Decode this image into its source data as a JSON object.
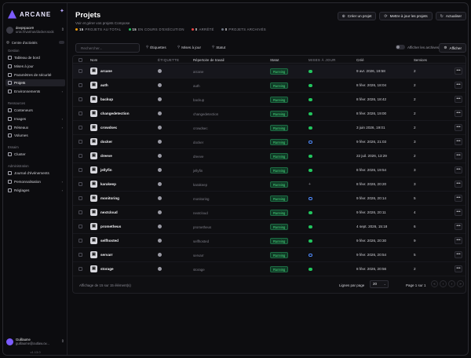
{
  "sidebar": {
    "logo_text": "ARCANE",
    "environment": {
      "name": "deepspace9",
      "url": "unix:///var/run/docker.sock"
    },
    "activity_label": "Centre d'activités",
    "sections": {
      "gestion": "Gestion",
      "ressources": "Ressources",
      "essaim": "Essaim",
      "administration": "Administration"
    },
    "gestion_items": [
      {
        "label": "Tableau de bord",
        "icon": "dashboard-icon"
      },
      {
        "label": "Mises à jour",
        "icon": "update-icon"
      },
      {
        "label": "Paramètres de sécurité",
        "icon": "shield-icon"
      },
      {
        "label": "Projets",
        "icon": "projects-icon"
      },
      {
        "label": "Environnements",
        "icon": "server-icon"
      }
    ],
    "ressources_items": [
      {
        "label": "Conteneurs",
        "icon": "container-icon"
      },
      {
        "label": "Images",
        "icon": "image-icon"
      },
      {
        "label": "Réseaux",
        "icon": "network-icon"
      },
      {
        "label": "Volumes",
        "icon": "volume-icon"
      }
    ],
    "essaim_items": [
      {
        "label": "Cluster",
        "icon": "cluster-icon"
      }
    ],
    "admin_items": [
      {
        "label": "Journal d'événements",
        "icon": "log-icon"
      },
      {
        "label": "Personnalisation",
        "icon": "brush-icon"
      },
      {
        "label": "Réglages",
        "icon": "settings-icon"
      }
    ],
    "user": {
      "name": "Guillaume",
      "email": "guillaume@outlaw.ov..."
    },
    "version": "v1.13.0"
  },
  "header": {
    "title": "Projets",
    "subtitle": "Voir et gérer vos projets Compose",
    "stats": [
      {
        "count": "15",
        "label": "PROJETS AU TOTAL",
        "color": "#f59e0b"
      },
      {
        "count": "15",
        "label": "EN COURS D'EXÉCUTION",
        "color": "#22c55e"
      },
      {
        "count": "0",
        "label": "ARRÊTÉ",
        "color": "#ef4444"
      },
      {
        "count": "0",
        "label": "PROJETS ARCHIVÉS",
        "color": "#6b7280"
      }
    ],
    "buttons": {
      "create": "Créer un projet",
      "update_all": "Mettre à jour les projets",
      "refresh": "Actualiser"
    }
  },
  "toolbar": {
    "search_placeholder": "Rechercher...",
    "filters": [
      "Étiquettes",
      "Mises à jour",
      "Statut"
    ],
    "archive_label": "Afficher les archives",
    "view_label": "Afficher"
  },
  "table": {
    "columns": {
      "name": "Nom",
      "tags": "ÉTIQUETTE",
      "dir": "Répertoire de travail",
      "status": "Statut",
      "updates": "MISES À JOUR",
      "created": "Créé",
      "services": "Services"
    },
    "rows": [
      {
        "name": "arcane",
        "dir": "arcane",
        "status": "Running",
        "update": "ok",
        "created": "9 avr. 2026, 19:58",
        "services": "2"
      },
      {
        "name": "auth",
        "dir": "auth",
        "status": "Running",
        "update": "ok",
        "created": "8 févr. 2026, 18:04",
        "services": "2"
      },
      {
        "name": "backup",
        "dir": "backup",
        "status": "Running",
        "update": "ok",
        "created": "8 févr. 2026, 18:42",
        "services": "2"
      },
      {
        "name": "changedetection",
        "dir": "changedetection",
        "status": "Running",
        "update": "ok",
        "created": "8 févr. 2026, 19:00",
        "services": "2"
      },
      {
        "name": "crowdsec",
        "dir": "crowdsec",
        "status": "Running",
        "update": "ok",
        "created": "3 juin 2026, 19:01",
        "services": "2"
      },
      {
        "name": "docker",
        "dir": "docker",
        "status": "Running",
        "update": "ring",
        "created": "9 févr. 2026, 21:03",
        "services": "3"
      },
      {
        "name": "dreeve",
        "dir": "dreeve",
        "status": "Running",
        "update": "ok",
        "created": "22 juil. 2026, 13:29",
        "services": "2"
      },
      {
        "name": "jellyfin",
        "dir": "jellyfin",
        "status": "Running",
        "update": "ok",
        "created": "8 févr. 2026, 19:54",
        "services": "3"
      },
      {
        "name": "karakeep",
        "dir": "karakeep",
        "status": "Running",
        "update": "plus",
        "created": "8 févr. 2026, 20:20",
        "services": "3"
      },
      {
        "name": "monitoring",
        "dir": "monitoring",
        "status": "Running",
        "update": "ring",
        "created": "9 févr. 2026, 20:14",
        "services": "5"
      },
      {
        "name": "nextcloud",
        "dir": "nextcloud",
        "status": "Running",
        "update": "ok",
        "created": "9 févr. 2026, 20:11",
        "services": "4"
      },
      {
        "name": "prometheus",
        "dir": "prometheus",
        "status": "Running",
        "update": "ok",
        "created": "4 sept. 2026, 15:18",
        "services": "6"
      },
      {
        "name": "selfhosted",
        "dir": "selfhosted",
        "status": "Running",
        "update": "ok",
        "created": "9 févr. 2026, 20:30",
        "services": "9"
      },
      {
        "name": "servarr",
        "dir": "servarr",
        "status": "Running",
        "update": "ring",
        "created": "9 févr. 2026, 20:54",
        "services": "5"
      },
      {
        "name": "storage",
        "dir": "storage",
        "status": "Running",
        "update": "ok",
        "created": "8 févr. 2026, 20:56",
        "services": "2"
      }
    ],
    "footer": {
      "showing": "Affichage de 15 sur 15 élément(s)",
      "per_page_label": "Lignes par page",
      "per_page": "20",
      "page_info": "Page 1 sur 1"
    }
  }
}
